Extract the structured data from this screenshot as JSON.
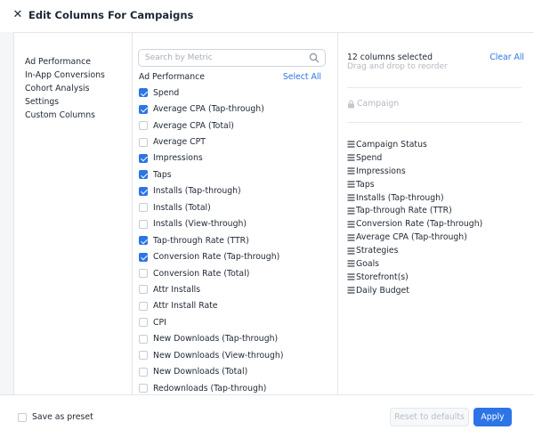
{
  "header": {
    "close_icon": "close-icon",
    "title": "Edit Columns For Campaigns"
  },
  "categories": [
    "Ad Performance",
    "In-App Conversions",
    "Cohort Analysis",
    "Settings",
    "Custom Columns"
  ],
  "search": {
    "placeholder": "Search by Metric",
    "value": ""
  },
  "metrics_section": {
    "label": "Ad Performance",
    "select_all": "Select All",
    "items": [
      {
        "label": "Spend",
        "checked": true
      },
      {
        "label": "Average CPA (Tap-through)",
        "checked": true
      },
      {
        "label": "Average CPA (Total)",
        "checked": false
      },
      {
        "label": "Average CPT",
        "checked": false
      },
      {
        "label": "Impressions",
        "checked": true
      },
      {
        "label": "Taps",
        "checked": true
      },
      {
        "label": "Installs (Tap-through)",
        "checked": true
      },
      {
        "label": "Installs (Total)",
        "checked": false
      },
      {
        "label": "Installs (View-through)",
        "checked": false
      },
      {
        "label": "Tap-through Rate (TTR)",
        "checked": true
      },
      {
        "label": "Conversion Rate (Tap-through)",
        "checked": true
      },
      {
        "label": "Conversion Rate (Total)",
        "checked": false
      },
      {
        "label": "Attr Installs",
        "checked": false
      },
      {
        "label": "Attr Install Rate",
        "checked": false
      },
      {
        "label": "CPI",
        "checked": false
      },
      {
        "label": "New Downloads (Tap-through)",
        "checked": false
      },
      {
        "label": "New Downloads (View-through)",
        "checked": false
      },
      {
        "label": "New Downloads (Total)",
        "checked": false
      },
      {
        "label": "Redownloads (Tap-through)",
        "checked": false
      }
    ]
  },
  "selected": {
    "count_text": "12 columns selected",
    "hint": "Drag and drop to reorder",
    "clear_all": "Clear All",
    "locked_column": "Campaign",
    "items": [
      "Campaign Status",
      "Spend",
      "Impressions",
      "Taps",
      "Installs (Tap-through)",
      "Tap-through Rate (TTR)",
      "Conversion Rate (Tap-through)",
      "Average CPA (Tap-through)",
      "Strategies",
      "Goals",
      "Storefront(s)",
      "Daily Budget"
    ]
  },
  "footer": {
    "save_preset": "Save as preset",
    "reset": "Reset to defaults",
    "apply": "Apply"
  },
  "colors": {
    "accent": "#2d74e6",
    "text": "#1f2733",
    "muted": "#b3b8c0",
    "border": "#e2e5ea",
    "background": "#f5f6f8"
  }
}
